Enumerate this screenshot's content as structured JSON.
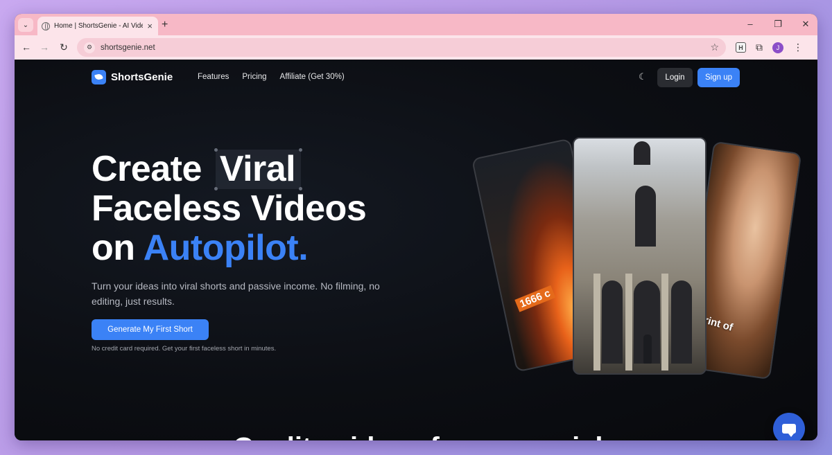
{
  "browser": {
    "tab_title": "Home | ShortsGenie - AI Video",
    "tab_close": "×",
    "new_tab": "+",
    "url": "shortsgenie.net",
    "ext_label": "H",
    "profile_initial": "J"
  },
  "nav": {
    "brand": "ShortsGenie",
    "links": [
      "Features",
      "Pricing",
      "Affiliate (Get 30%)"
    ],
    "login": "Login",
    "signup": "Sign up"
  },
  "hero": {
    "line1_prefix": "Create",
    "line1_highlight": "Viral",
    "line2": "Faceless Videos",
    "line3_prefix": "on",
    "line3_accent": "Autopilot.",
    "subtitle": "Turn your ideas into viral shorts and passive income. No filming, no editing, just results.",
    "cta": "Generate My First Short",
    "note": "No credit card required. Get your first faceless short in minutes."
  },
  "cards": {
    "left_caption": "1666 c",
    "right_caption": "rint of"
  },
  "section": {
    "title_partial": "Quality videos for every niche"
  },
  "colors": {
    "accent": "#3b82f6",
    "page_bg": "#0c0e13",
    "tab_bar": "#f7b8c6",
    "chat": "#2f5fd8"
  }
}
